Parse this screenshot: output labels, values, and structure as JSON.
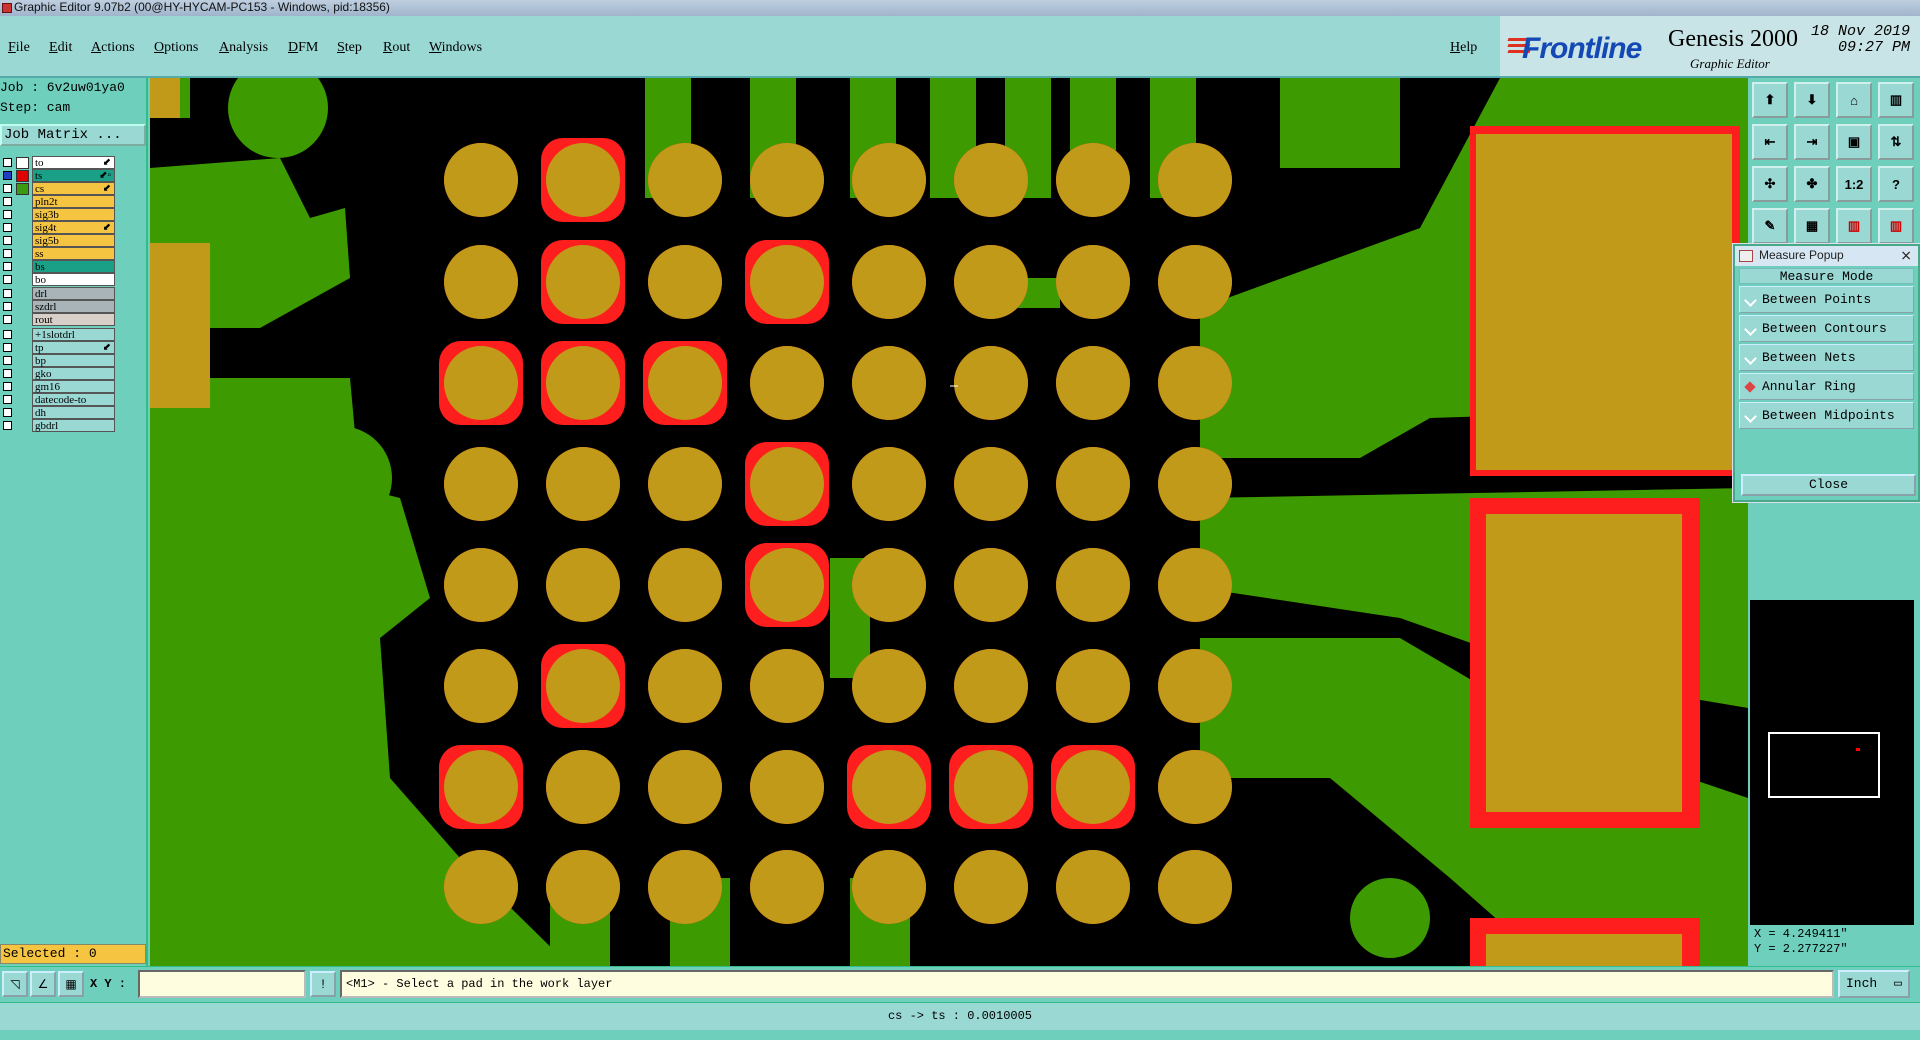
{
  "window": {
    "title": "Graphic Editor 9.07b2 (00@HY-HYCAM-PC153 - Windows, pid:18356)"
  },
  "menu": [
    "File",
    "Edit",
    "Actions",
    "Options",
    "Analysis",
    "DFM",
    "Step",
    "Rout",
    "Windows"
  ],
  "help_label": "Help",
  "brand": {
    "logo": "Frontline",
    "product": "Genesis 2000",
    "subtitle": "Graphic Editor",
    "date": "18 Nov 2019",
    "time": "09:27 PM"
  },
  "job": {
    "job_line": "Job : 6v2uw01ya0",
    "step_line": "Step: cam",
    "matrix_button": "Job Matrix ..."
  },
  "layers": [
    {
      "name": "to",
      "color": "#ffffff",
      "swatch": "#ffffff",
      "flag": "⬋"
    },
    {
      "name": "ts",
      "color": "#1aa087",
      "swatch": "#e00000",
      "flag": "⬋▫",
      "checked_color": "#2040c0"
    },
    {
      "name": "cs",
      "color": "#f5c542",
      "swatch": "#3a9a10",
      "flag": "⬋"
    },
    {
      "name": "pln2t",
      "color": "#f5c542",
      "swatch": "",
      "flag": ""
    },
    {
      "name": "sig3b",
      "color": "#f5c542",
      "swatch": "",
      "flag": ""
    },
    {
      "name": "sig4t",
      "color": "#f5c542",
      "swatch": "",
      "flag": "⬋"
    },
    {
      "name": "sig5b",
      "color": "#f5c542",
      "swatch": "",
      "flag": ""
    },
    {
      "name": "ss",
      "color": "#f5c542",
      "swatch": "",
      "flag": ""
    },
    {
      "name": "bs",
      "color": "#1aa087",
      "swatch": "",
      "flag": ""
    },
    {
      "name": "bo",
      "color": "#ffffff",
      "swatch": "",
      "flag": ""
    },
    {
      "name": "drl",
      "color": "#a8b4b8",
      "swatch": "",
      "flag": ""
    },
    {
      "name": "szdrl",
      "color": "#a8b4b8",
      "swatch": "",
      "flag": ""
    },
    {
      "name": "rout",
      "color": "#d8d0c8",
      "swatch": "",
      "flag": ""
    },
    {
      "name": "+1slotdrl",
      "color": "#9ad8d4",
      "swatch": "",
      "flag": ""
    },
    {
      "name": "tp",
      "color": "#9ad8d4",
      "swatch": "",
      "flag": "⬋"
    },
    {
      "name": "bp",
      "color": "#9ad8d4",
      "swatch": "",
      "flag": ""
    },
    {
      "name": "gko",
      "color": "#9ad8d4",
      "swatch": "",
      "flag": ""
    },
    {
      "name": "gm16",
      "color": "#9ad8d4",
      "swatch": "",
      "flag": ""
    },
    {
      "name": "datecode-to",
      "color": "#9ad8d4",
      "swatch": "",
      "flag": ""
    },
    {
      "name": "dh",
      "color": "#9ad8d4",
      "swatch": "",
      "flag": ""
    },
    {
      "name": "gbdrl",
      "color": "#9ad8d4",
      "swatch": "",
      "flag": ""
    }
  ],
  "selected": "Selected : 0",
  "toolbar": [
    "",
    "",
    "",
    "",
    "",
    "",
    "",
    "",
    "",
    "",
    "1:2",
    "?",
    "",
    "",
    "",
    ""
  ],
  "measure": {
    "title": "Measure Popup",
    "mode_label": "Measure Mode",
    "options": [
      "Between Points",
      "Between Contours",
      "Between Nets",
      "Annular Ring",
      "Between Midpoints"
    ],
    "selected": "Annular Ring",
    "close": "Close"
  },
  "coords": {
    "x": "X = 4.249411\"",
    "y": "Y = 2.277227\""
  },
  "bottom": {
    "xy_label": "X Y :",
    "xy_value": "",
    "message": "<M1> - Select a pad in the work layer",
    "unit": "Inch"
  },
  "status": "cs -> ts : 0.0010005",
  "colors": {
    "board": "#000000",
    "copper": "#3d9a00",
    "pad": "#ff1e1e",
    "mask": "#c09a18"
  }
}
